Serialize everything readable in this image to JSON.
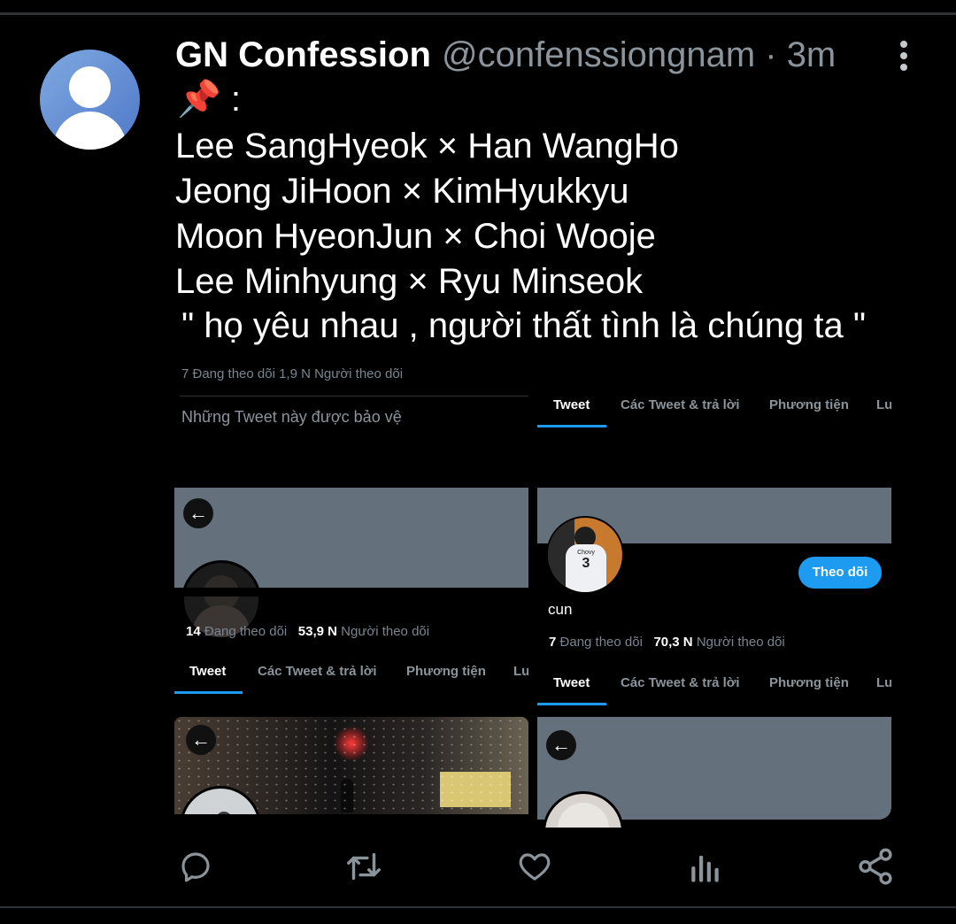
{
  "tweet": {
    "display_name": "GN Confession",
    "handle_time": "@confenssiongnam · 3m",
    "pin_emoji": "📌",
    "pin_suffix": " :",
    "lines": [
      "Lee SangHyeok × Han WangHo",
      "Jeong JiHoon × KimHyukkyu",
      "Moon HyeonJun × Choi Wooje",
      "Lee Minhyung × Ryu Minseok"
    ],
    "quote": "\" họ yêu nhau , người thất tình là chúng ta \""
  },
  "collage": {
    "top_left": {
      "cut_stats": "7 Đang theo dõi   1,9 N  Người theo dõi",
      "protected_text": "Những Tweet này được bảo vệ"
    },
    "top_right": {
      "tabs": [
        "Tweet",
        "Các Tweet & trả lời",
        "Phương tiện",
        "Lư"
      ]
    },
    "mid_left": {
      "following_count": "14",
      "following_label": "Đang theo dõi",
      "followers_count": "53,9 N",
      "followers_label": "Người theo dõi",
      "tabs": [
        "Tweet",
        "Các Tweet & trả lời",
        "Phương tiện",
        "Lư"
      ]
    },
    "mid_right": {
      "jersey_text": "Chovy",
      "jersey_number": "3",
      "follow_label": "Theo dõi",
      "name": "cun",
      "following_count": "7",
      "following_label": "Đang theo dõi",
      "followers_count": "70,3 N",
      "followers_label": "Người theo dõi",
      "tabs": [
        "Tweet",
        "Các Tweet & trả lời",
        "Phương tiện",
        "Lư"
      ]
    }
  },
  "actions": [
    "reply-icon",
    "retweet-icon",
    "like-icon",
    "analytics-icon",
    "share-icon"
  ],
  "colors": {
    "accent": "#1d9bf0",
    "banner": "#64717d",
    "muted": "#8b949b"
  }
}
